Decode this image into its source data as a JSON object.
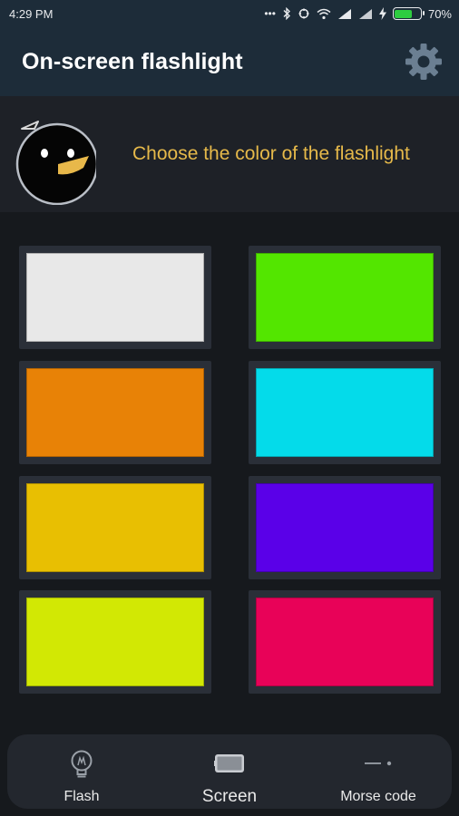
{
  "status_bar": {
    "time": "4:29 PM",
    "dots": "•••",
    "battery_percent": "70%",
    "battery_level": 0.7
  },
  "app_bar": {
    "title": "On-screen flashlight",
    "settings_icon": "gear-icon"
  },
  "header": {
    "instruction": "Choose the color of the flashlight"
  },
  "colors": [
    {
      "name": "white",
      "hex": "#e8e8e8"
    },
    {
      "name": "green",
      "hex": "#53e600"
    },
    {
      "name": "orange",
      "hex": "#e88206"
    },
    {
      "name": "cyan",
      "hex": "#04dbea"
    },
    {
      "name": "yellow",
      "hex": "#e8bf02"
    },
    {
      "name": "violet",
      "hex": "#5a00e8"
    },
    {
      "name": "lime",
      "hex": "#d2e804"
    },
    {
      "name": "crimson",
      "hex": "#e80258"
    }
  ],
  "bottom_nav": {
    "items": [
      {
        "label": "Flash",
        "icon": "bulb-icon"
      },
      {
        "label": "Screen",
        "icon": "phone-screen-icon",
        "selected": true
      },
      {
        "label": "Morse code",
        "icon": "morse-dash-dot-icon"
      }
    ]
  },
  "accent": "#e6b94a"
}
